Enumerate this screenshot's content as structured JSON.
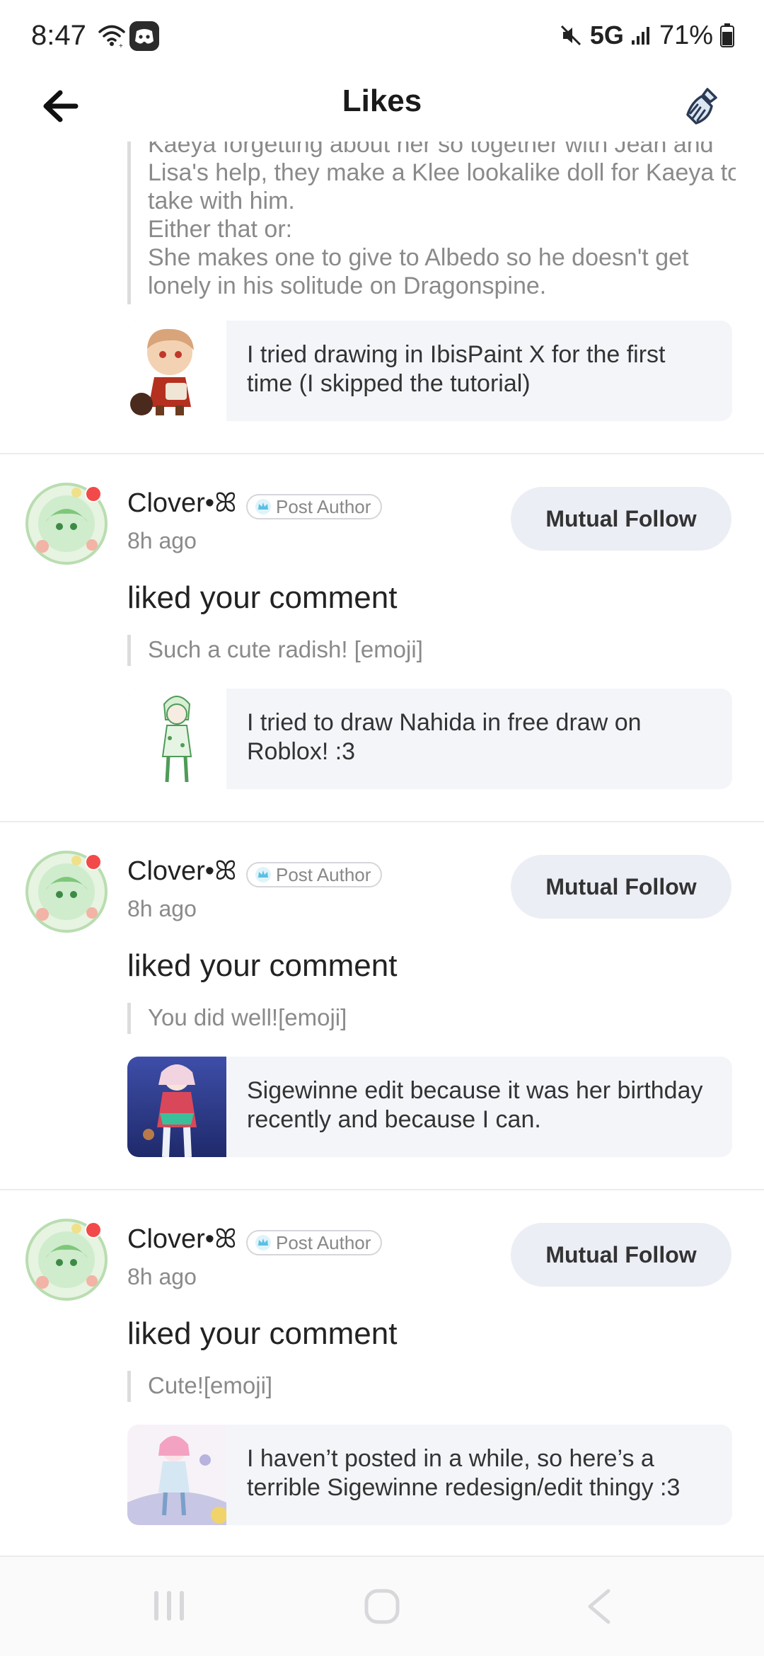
{
  "status_bar": {
    "time": "8:47",
    "network": "5G",
    "battery": "71%",
    "icons": [
      "wifi-icon",
      "discord-icon",
      "mute-icon",
      "signal-icon",
      "battery-icon"
    ]
  },
  "header": {
    "title": "Likes",
    "back_icon": "arrow-left-icon",
    "right_icon": "cleaning-brush-icon"
  },
  "partial_item": {
    "quote_lines": [
      "Kaeya forgetting about her so together with Jean and",
      "Lisa's help, they make a Klee lookalike doll for Kaeya to",
      "take with him.",
      "Either that or:",
      "She makes one to give to Albedo so he doesn't get",
      "lonely in his solitude on Dragonspine."
    ],
    "post_text": "I tried drawing in IbisPaint X for the first time (I skipped the tutorial)"
  },
  "notifications": [
    {
      "user": "Clover•ꕤ",
      "badge": "Post Author",
      "time": "8h ago",
      "follow_label": "Mutual Follow",
      "action": "liked your comment",
      "comment": "Such a cute radish! [emoji]",
      "post_text": "I tried to draw Nahida in free draw on Roblox! :3"
    },
    {
      "user": "Clover•ꕤ",
      "badge": "Post Author",
      "time": "8h ago",
      "follow_label": "Mutual Follow",
      "action": "liked your comment",
      "comment": "You did well![emoji]",
      "post_text": "Sigewinne edit because it was her birthday recently and because I can."
    },
    {
      "user": "Clover•ꕤ",
      "badge": "Post Author",
      "time": "8h ago",
      "follow_label": "Mutual Follow",
      "action": "liked your comment",
      "comment": "Cute![emoji]",
      "post_text": "I haven’t posted in a while, so here’s a terrible Sigewinne redesign/edit thingy :3"
    }
  ],
  "nav_bar": {
    "icons": [
      "recent-apps-icon",
      "home-icon",
      "back-icon"
    ]
  },
  "colors": {
    "card_bg": "#f4f5f9",
    "button_bg": "#eceef6",
    "unread_dot": "#f24a4a",
    "muted_text": "#8a8a8a"
  }
}
